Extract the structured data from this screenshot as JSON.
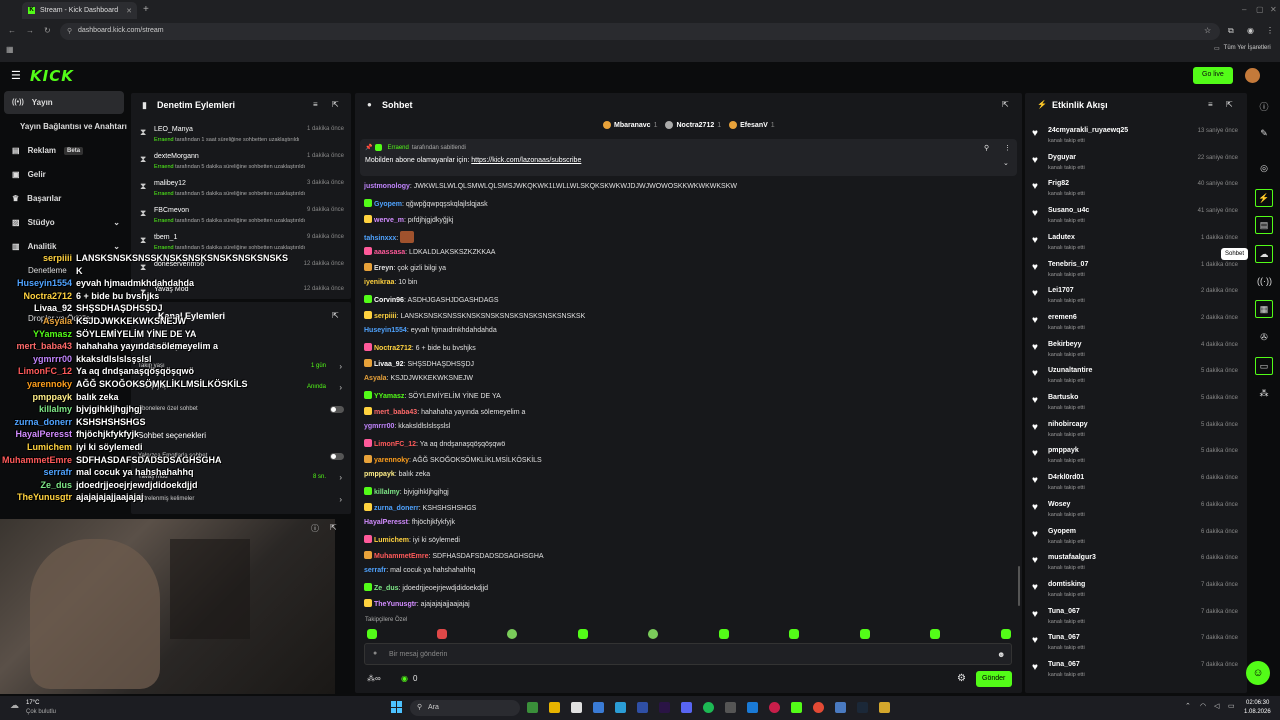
{
  "browser": {
    "tab_title": "Stream - Kick Dashboard",
    "url": "dashboard.kick.com/stream",
    "bookmarks_label": "Tüm Yer İşaretleri"
  },
  "header": {
    "logo": "KICK",
    "go_live": "Go live"
  },
  "sidebar": {
    "items": [
      {
        "label": "Yayın",
        "icon": "broadcast-icon"
      },
      {
        "label": "Yayın Bağlantısı ve Anahtarı",
        "icon": ""
      },
      {
        "label": "Reklam",
        "icon": "megaphone-icon",
        "badge": "Beta"
      },
      {
        "label": "Gelir",
        "icon": "dollar-icon"
      },
      {
        "label": "Başarılar",
        "icon": "trophy-icon"
      },
      {
        "label": "Stüdyo",
        "icon": "studio-icon"
      },
      {
        "label": "Analitik",
        "icon": "chart-icon"
      },
      {
        "label": "Denetleme",
        "icon": "shield-icon"
      },
      {
        "label": "Droplar ve Ödüller",
        "icon": "gift-icon"
      }
    ]
  },
  "mod_panel": {
    "title": "Denetim Eylemleri",
    "rows": [
      {
        "name": "LEO_Manya",
        "by": "Erraend",
        "desc": " tarafından 1 saat süreliğine sohbetten uzaklaştırıldı",
        "time": "1 dakika önce"
      },
      {
        "name": "dexteMorgann",
        "by": "Erraend",
        "desc": " tarafından 5 dakika süreliğine sohbetten uzaklaştırıldı",
        "time": "1 dakika önce"
      },
      {
        "name": "malibey12",
        "by": "Erraend",
        "desc": " tarafından 5 dakika süreliğine sohbetten uzaklaştırıldı",
        "time": "3 dakika önce"
      },
      {
        "name": "FBCmevon",
        "by": "Erraend",
        "desc": " tarafından 5 dakika süreliğine sohbetten uzaklaştırıldı",
        "time": "9 dakika önce"
      },
      {
        "name": "tbem_1",
        "by": "Erraend",
        "desc": " tarafından 5 dakika süreliğine sohbetten uzaklaştırıldı",
        "time": "9 dakika önce"
      },
      {
        "name": "doneserverim56",
        "by": "",
        "desc": "",
        "time": "12 dakika önce"
      },
      {
        "name": "Yavaş Mod",
        "by": "",
        "desc": "",
        "time": "12 dakika önce"
      }
    ]
  },
  "channel_panel": {
    "title": "Kanal Eylemleri",
    "rows": [
      {
        "label": "Sohbet erişimi",
        "value": ""
      },
      {
        "label": "Takip yaşı",
        "value": "1 gün"
      },
      {
        "label": "Hesap yaşı",
        "value": "Anında"
      },
      {
        "label": "Abonelere özel sohbet",
        "value": ""
      },
      {
        "label": "Sohbet seçenekleri",
        "value": ""
      },
      {
        "label": "Yalnızca Emotlarla sohbet",
        "value": ""
      },
      {
        "label": "Yavaş mod",
        "value": "8 sn."
      },
      {
        "label": "Filtrelenmiş kelimeler",
        "value": ""
      }
    ]
  },
  "overlay_chat": [
    {
      "user": "serpiiii",
      "msg": "LANSKSNSKSNSSKNSKSNSKSNSKSNSKSNSKS",
      "color": "#ffd23f"
    },
    {
      "user": "",
      "msg": "K",
      "color": "#fff"
    },
    {
      "user": "Huseyin1554",
      "msg": "eyvah hjmaıdmkhdahdahda",
      "color": "#4fa3ff"
    },
    {
      "user": "Noctra2712",
      "msg": "6 + bide bu bvshjks",
      "color": "#ffd23f"
    },
    {
      "user": "Livaa_92",
      "msg": "SHŞSDHAŞDHSŞDJ",
      "color": "#fff"
    },
    {
      "user": "Asyala",
      "msg": "KSJDJWKKEKWKSNEJW",
      "color": "#e8a23a"
    },
    {
      "user": "YYamasz",
      "msg": "SÖYLEMİYELİM YİNE DE YA",
      "color": "#53fc18"
    },
    {
      "user": "mert_baba43",
      "msg": "hahahaha yayında sölemeyelim a",
      "color": "#ff6a6a"
    },
    {
      "user": "ygmrrr00",
      "msg": "kkaksldlslslsşslsl",
      "color": "#c084fc"
    },
    {
      "user": "LimonFC_12",
      "msg": "Ya aq dndşanaşqöşqöşqwö",
      "color": "#ff5a5a"
    },
    {
      "user": "yarennoky",
      "msg": "AĞĞ SKOĞOKSÖMKLİKLMSİLKÖSKİLS",
      "color": "#ff9f1c"
    },
    {
      "user": "pmppayk",
      "msg": "balık zeka",
      "color": "#ffee88"
    },
    {
      "user": "killalmy",
      "msg": "bjvjgihkljhgjhgj",
      "color": "#7ee787"
    },
    {
      "user": "zurna_donerr",
      "msg": "KSHSHSHSHGS",
      "color": "#4fa3ff"
    },
    {
      "user": "HayalPeresst",
      "msg": "fhjöchjkfykfyjk",
      "color": "#d28cff"
    },
    {
      "user": "Lumichem",
      "msg": "iyi ki söylemedi",
      "color": "#ffd23f"
    },
    {
      "user": "MuhammetEmre",
      "msg": "SDFHASDAFSDADSDSAGHSGHA",
      "color": "#ff5a5a"
    },
    {
      "user": "serrafr",
      "msg": "mal cocuk ya hahshahahhq",
      "color": "#4fa3ff"
    },
    {
      "user": "Ze_dus",
      "msg": "jdoedrjjeoejrjewdjdidoekdjjd",
      "color": "#7ee787"
    },
    {
      "user": "TheYunusgtr",
      "msg": "ajajajajajjaajajaj",
      "color": "#ffd23f"
    }
  ],
  "chat": {
    "title": "Sohbet",
    "top_gifters": [
      {
        "name": "Mbaranavc",
        "count": "1"
      },
      {
        "name": "Noctra2712",
        "count": "1"
      },
      {
        "name": "EfesanV",
        "count": "1"
      }
    ],
    "pinned": {
      "by": "Erraend",
      "label": "tarafından sabitlendi",
      "text": "Mobilden abone olamayanlar için: ",
      "link": "https://kick.com/lazonaas/subscribe"
    },
    "messages": [
      {
        "user": "justmonology",
        "msg": "JWKWLSLWLQLSMWLQLSMSJWKQKWK1LWLLWLSKQKSKWKWJDJWJWOWOSKKWKWKWKSKW",
        "color": "#c084fc"
      },
      {
        "user": "Gyopem",
        "msg": "qğwpğqwpqşskqlajlslqjask",
        "color": "#4fa3ff"
      },
      {
        "user": "werve_m",
        "msg": "pıfdjhjgjdkyğjkj",
        "color": "#d28cff"
      },
      {
        "user": "tahsinxxx",
        "msg": "",
        "color": "#4fa3ff"
      },
      {
        "user": "aaassasa",
        "msg": "LDKALDLAKSKSZKZKKAA",
        "color": "#ff5a9a"
      },
      {
        "user": "Ereyn",
        "msg": "çok gizli bilgi ya",
        "color": "#e0e0e0"
      },
      {
        "user": "iyenikraa",
        "msg": "10 bin",
        "color": "#ffd23f"
      },
      {
        "user": "Corvin96",
        "msg": "ASDHJGASHJDGASHDAGS",
        "color": "#fff"
      },
      {
        "user": "serpiiii",
        "msg": "LANSKSNSKSNSSKNSKSNSKSNSKSNSKSNSKSNSKSK",
        "color": "#ffd23f"
      },
      {
        "user": "Huseyin1554",
        "msg": "eyvah hjmaıdmkhdahdahda",
        "color": "#4fa3ff"
      },
      {
        "user": "Noctra2712",
        "msg": "6 + bide bu bvshjks",
        "color": "#ffd23f"
      },
      {
        "user": "Livaa_92",
        "msg": "SHŞSDHAŞDHSŞDJ",
        "color": "#fff"
      },
      {
        "user": "Asyala",
        "msg": "KSJDJWKKEKWKSNEJW",
        "color": "#e8a23a"
      },
      {
        "user": "YYamasz",
        "msg": "SÖYLEMİYELİM YİNE DE YA",
        "color": "#53fc18"
      },
      {
        "user": "mert_baba43",
        "msg": "hahahaha yayında sölemeyelim a",
        "color": "#ff6a6a"
      },
      {
        "user": "ygmrrr00",
        "msg": "kkaksldlslslsşslsl",
        "color": "#c084fc"
      },
      {
        "user": "LimonFC_12",
        "msg": "Ya aq dndşanaşqöşqöşqwö",
        "color": "#ff5a5a"
      },
      {
        "user": "yarennoky",
        "msg": "AĞĞ SKOĞOKSÖMKLİKLMSİLKÖSKİLS",
        "color": "#ff9f1c"
      },
      {
        "user": "pmppayk",
        "msg": "balık zeka",
        "color": "#ffee88"
      },
      {
        "user": "killalmy",
        "msg": "bjvjgihkljhgjhgj",
        "color": "#7ee787"
      },
      {
        "user": "zurna_donerr",
        "msg": "KSHSHSHSHGS",
        "color": "#4fa3ff"
      },
      {
        "user": "HayalPeresst",
        "msg": "fhjöchjkfykfyjk",
        "color": "#d28cff"
      },
      {
        "user": "Lumichem",
        "msg": "iyi ki söylemedi",
        "color": "#ffd23f"
      },
      {
        "user": "MuhammetEmre",
        "msg": "SDFHASDAFSDADSDSAGHSGHA",
        "color": "#ff5a5a"
      },
      {
        "user": "serrafr",
        "msg": "mal cocuk ya hahshahahhq",
        "color": "#4fa3ff"
      },
      {
        "user": "Ze_dus",
        "msg": "jdoedrjjeoejrjewdjdidoekdjjd",
        "color": "#7ee787"
      },
      {
        "user": "TheYunusgtr",
        "msg": "ajajajajajjaajajaj",
        "color": "#d28cff"
      }
    ],
    "emote_section": "Takipçilere Özel",
    "input_placeholder": "Bir mesaj gönderin",
    "points": "0",
    "send_label": "Gönder"
  },
  "events": {
    "title": "Etkinlik Akışı",
    "rows": [
      {
        "name": "24cmyarakli_ruyaewq25",
        "sub": "kanalı takip etti",
        "time": "13 saniye önce"
      },
      {
        "name": "Dyguyar",
        "sub": "kanalı takip etti",
        "time": "22 saniye önce"
      },
      {
        "name": "Frig82",
        "sub": "kanalı takip etti",
        "time": "40 saniye önce"
      },
      {
        "name": "Susano_u4c",
        "sub": "kanalı takip etti",
        "time": "41 saniye önce"
      },
      {
        "name": "Ladutex",
        "sub": "kanalı takip etti",
        "time": "1 dakika önce"
      },
      {
        "name": "Tenebris_07",
        "sub": "kanalı takip etti",
        "time": "1 dakika önce"
      },
      {
        "name": "Lei1707",
        "sub": "kanalı takip etti",
        "time": "2 dakika önce"
      },
      {
        "name": "eremen6",
        "sub": "kanalı takip etti",
        "time": "2 dakika önce"
      },
      {
        "name": "Bekirbeyy",
        "sub": "kanalı takip etti",
        "time": "4 dakika önce"
      },
      {
        "name": "Uzunaltantire",
        "sub": "kanalı takip etti",
        "time": "5 dakika önce"
      },
      {
        "name": "Bartusko",
        "sub": "kanalı takip etti",
        "time": "5 dakika önce"
      },
      {
        "name": "nihobircapy",
        "sub": "kanalı takip etti",
        "time": "5 dakika önce"
      },
      {
        "name": "pmppayk",
        "sub": "kanalı takip etti",
        "time": "5 dakika önce"
      },
      {
        "name": "D4rkl0rd01",
        "sub": "kanalı takip etti",
        "time": "6 dakika önce"
      },
      {
        "name": "Wosey",
        "sub": "kanalı takip etti",
        "time": "6 dakika önce"
      },
      {
        "name": "Gyopem",
        "sub": "kanalı takip etti",
        "time": "6 dakika önce"
      },
      {
        "name": "mustafaalgur3",
        "sub": "kanalı takip etti",
        "time": "6 dakika önce"
      },
      {
        "name": "domtisking",
        "sub": "kanalı takip etti",
        "time": "7 dakika önce"
      },
      {
        "name": "Tuna_067",
        "sub": "kanalı takip etti",
        "time": "7 dakika önce"
      },
      {
        "name": "Tuna_067",
        "sub": "kanalı takip etti",
        "time": "7 dakika önce"
      },
      {
        "name": "Tuna_067",
        "sub": "kanalı takip etti",
        "time": "7 dakika önce"
      }
    ]
  },
  "tooltip": "Sohbet",
  "taskbar": {
    "weather_temp": "17°C",
    "weather_desc": "Çok bulutlu",
    "search": "Ara",
    "time": "02:06:30",
    "date": "1.08.2026"
  },
  "colors": {
    "accent": "#53fc18",
    "panel": "#17181b",
    "bg": "#0b0c0d"
  }
}
